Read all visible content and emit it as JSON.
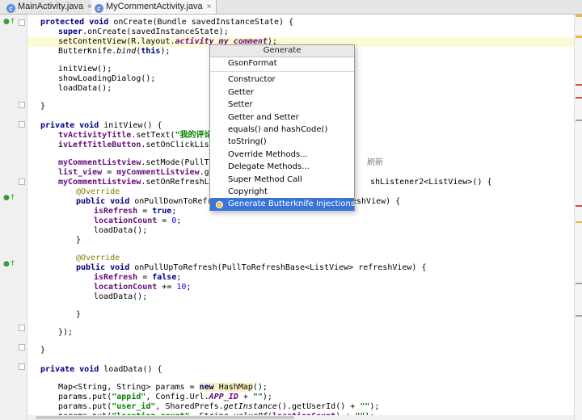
{
  "tabs": [
    {
      "icon": "c-class-icon",
      "label": "MainActivity.java",
      "close": "×"
    },
    {
      "icon": "c-class-icon",
      "label": "MyCommentActivity.java",
      "close": "×"
    }
  ],
  "code": {
    "l1_a": "protected void ",
    "l1_b": "onCreate(Bundle savedInstanceState) {",
    "l2_a": "super",
    "l2_b": ".onCreate(savedInstanceState);",
    "l3_a": "setContentView(R.layout.",
    "l3_b": "activity_my_comment",
    "l3_c": ");",
    "l4_a": "ButterKnife.",
    "l4_b": "bind",
    "l4_c": "(",
    "l4_d": "this",
    "l4_e": ");",
    "l5": "initView();",
    "l6": "showLoadingDialog();",
    "l7": "loadData();",
    "l8": "}",
    "l9_a": "private void ",
    "l9_b": "initView() {",
    "l10_a": "tvActivityTitle",
    "l10_b": ".setText(",
    "l10_c": "\"我的评论\"",
    "l10_d": ");",
    "l11_a": "ivLeftTitleButton",
    "l11_b": ".setOnClickListene",
    "l12_a": "myCommentListview",
    "l12_b": ".setMode(PullToRef",
    "l12_comment": "刷新",
    "l13_a": "list_view",
    "l13_b": " = ",
    "l13_c": "myCommentListview",
    "l13_d": ".getRe",
    "l14_a": "myCommentListview",
    "l14_b": ".setOnRefreshListe",
    "l14_tail": "shListener2<ListView>() {",
    "l15": "@Override",
    "l16_a": "public void ",
    "l16_b": "onPullDownToRefresh",
    "l16_tail": "eshView) {",
    "l17_a": "isRefresh",
    "l17_b": " = ",
    "l17_c": "true",
    "l17_d": ";",
    "l18_a": "locationCount",
    "l18_b": " = ",
    "l18_c": "0",
    "l18_d": ";",
    "l19": "loadData();",
    "l20": "}",
    "l21": "@Override",
    "l22_a": "public void ",
    "l22_b": "onPullUpToRefresh(PullToRefreshBase<ListView> refreshView) {",
    "l23_a": "isRefresh",
    "l23_b": " = ",
    "l23_c": "false",
    "l23_d": ";",
    "l24_a": "locationCount",
    "l24_b": " += ",
    "l24_c": "10",
    "l24_d": ";",
    "l25": "loadData();",
    "l26": "}",
    "l27": "});",
    "l28": "}",
    "l29_a": "private void ",
    "l29_b": "loadData() {",
    "l30_a": "Map<String, String> params = ",
    "l30_b": "new ",
    "l30_c": "HashMap",
    "l30_d": "();",
    "l31_a": "params.put(",
    "l31_b": "\"appid\"",
    "l31_c": ", Config.Url.",
    "l31_d": "APP_ID",
    "l31_e": " + ",
    "l31_f": "\"\"",
    "l31_g": ");",
    "l32_a": "params.put(",
    "l32_b": "\"user_id\"",
    "l32_c": ", SharedPrefs.",
    "l32_d": "getInstance",
    "l32_e": "().getUserId() + ",
    "l32_f": "\"\"",
    "l32_g": ");",
    "l33_a": "params.put(",
    "l33_b": "\"location_count\"",
    "l33_c": ", String.",
    "l33_d": "valueOf",
    "l33_e": "(",
    "l33_f": "locationCount",
    "l33_g": ") + ",
    "l33_h": "\"\"",
    "l33_i": ");"
  },
  "popup": {
    "title": "Generate",
    "items": [
      "GsonFormat",
      "Constructor",
      "Getter",
      "Setter",
      "Getter and Setter",
      "equals() and hashCode()",
      "toString()",
      "Override Methods...",
      "Delegate Methods...",
      "Super Method Call",
      "Copyright",
      "Generate Butterknife Injections"
    ]
  },
  "colors": {
    "selection": "#3875d7",
    "keyword": "#000080",
    "field": "#660e7a",
    "string": "#008000",
    "number": "#0000ff",
    "annotation": "#808000",
    "current_line": "#fdfbd6"
  }
}
